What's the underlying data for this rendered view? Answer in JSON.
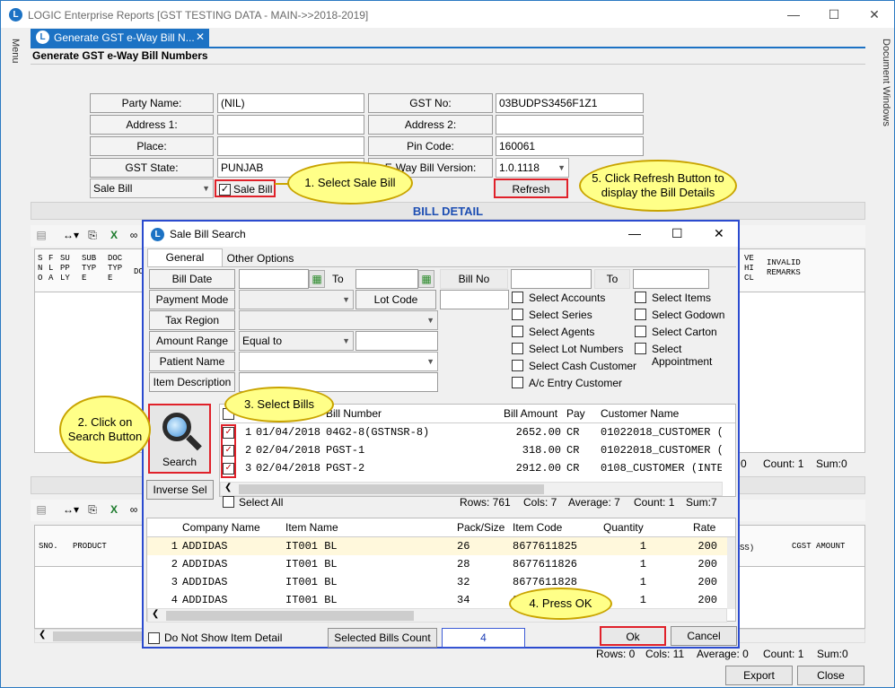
{
  "window": {
    "title": "LOGIC Enterprise Reports  [GST TESTING DATA - MAIN->>2018-2019]",
    "logo_letter": "L"
  },
  "side": {
    "left_label": "Menu",
    "right_label": "Document Windows"
  },
  "tab": {
    "label": "Generate GST e-Way Bill N...",
    "close": "✕"
  },
  "form": {
    "heading": "Generate GST e-Way Bill Numbers",
    "party_name_label": "Party Name:",
    "party_name": "(NIL)",
    "address1_label": "Address 1:",
    "address1": "",
    "place_label": "Place:",
    "place": "",
    "gst_state_label": "GST State:",
    "gst_state": "PUNJAB",
    "gst_no_label": "GST No:",
    "gst_no": "03BUDPS3456F1Z1",
    "address2_label": "Address 2:",
    "address2": "",
    "pin_code_label": "Pin Code:",
    "pin_code": "160061",
    "eway_version_label": "E-Way Bill Version:",
    "eway_version": "1.0.1118",
    "bill_type": "Sale Bill",
    "sale_bill_check_label": "Sale Bill",
    "refresh_label": "Refresh",
    "bill_detail_title": "BILL DETAIL"
  },
  "upper_grid": {
    "headers": [
      "S\nN\nO",
      "F\nL\nA",
      "SU\nPP\nLY",
      "SUB\nTYP\nE",
      "DOC\nTYP\nE",
      "DC"
    ],
    "right_headers": [
      "VE\nHI\nCL",
      "INVALID\nREMARKS"
    ],
    "status": {
      "partial": "0",
      "count": "Count: 1",
      "sum": "Sum:0"
    }
  },
  "lower_grid": {
    "headers": {
      "sno": "SNO.",
      "product": "PRODUCT",
      "ss": "SS)",
      "cgst": "CGST AMOUNT"
    },
    "status": {
      "rows": "Rows: 0",
      "cols": "Cols: 11",
      "average": "Average: 0",
      "count": "Count: 1",
      "sum": "Sum:0"
    }
  },
  "footer": {
    "export": "Export",
    "close": "Close"
  },
  "dialog": {
    "title": "Sale Bill Search",
    "tabs": [
      "General Options",
      "Other Options"
    ],
    "bill_date_label": "Bill Date",
    "to_label": "To",
    "bill_no_label": "Bill No",
    "to2_label": "To",
    "payment_mode_label": "Payment Mode",
    "lot_code_label": "Lot Code",
    "tax_region_label": "Tax Region",
    "amount_range_label": "Amount Range",
    "amount_range_value": "Equal to",
    "patient_name_label": "Patient Name",
    "item_description_label": "Item Description",
    "checks_mid": [
      "Select Accounts",
      "Select Series",
      "Select Agents",
      "Select Lot Numbers",
      "Select Cash Customer",
      "A/c Entry Customer"
    ],
    "checks_right": [
      "Select Items",
      "Select Godown",
      "Select Carton",
      "Select Appointment"
    ],
    "search_label": "Search",
    "inverse_sel_label": "Inverse Sel",
    "select_all_label": "Select All",
    "bills": {
      "headers": {
        "bill_number": "Bill Number",
        "bill_amount": "Bill Amount",
        "pay": "Pay",
        "customer": "Customer Name"
      },
      "rows": [
        {
          "n": "1",
          "date": "01/04/2018",
          "number": "04G2-8(GSTNSR-8)",
          "amount": "2652.00",
          "pay": "CR",
          "customer": "01022018_CUSTOMER (",
          "checked": true
        },
        {
          "n": "2",
          "date": "02/04/2018",
          "number": "PGST-1",
          "amount": "318.00",
          "pay": "CR",
          "customer": "01022018_CUSTOMER (",
          "checked": true
        },
        {
          "n": "3",
          "date": "02/04/2018",
          "number": "PGST-2",
          "amount": "2912.00",
          "pay": "CR",
          "customer": "0108_CUSTOMER (INTE",
          "checked": true
        }
      ],
      "status": {
        "rows": "Rows: 761",
        "cols": "Cols: 7",
        "average": "Average: 7",
        "count": "Count: 1",
        "sum": "Sum:7"
      }
    },
    "items": {
      "headers": {
        "company": "Company Name",
        "item": "Item Name",
        "pack": "Pack/Size",
        "code": "Item Code",
        "qty": "Quantity",
        "rate": "Rate"
      },
      "rows": [
        {
          "n": "1",
          "company": "ADDIDAS",
          "item": "IT001 BL",
          "pack": "26",
          "code": "8677611825",
          "qty": "1",
          "rate": "200"
        },
        {
          "n": "2",
          "company": "ADDIDAS",
          "item": "IT001 BL",
          "pack": "28",
          "code": "8677611826",
          "qty": "1",
          "rate": "200"
        },
        {
          "n": "3",
          "company": "ADDIDAS",
          "item": "IT001 BL",
          "pack": "32",
          "code": "8677611828",
          "qty": "1",
          "rate": "200"
        },
        {
          "n": "4",
          "company": "ADDIDAS",
          "item": "IT001 BL",
          "pack": "34",
          "code": "8677611830",
          "qty": "1",
          "rate": "200"
        }
      ]
    },
    "dont_show_label": "Do Not Show Item Detail",
    "selected_bills_label": "Selected Bills Count",
    "selected_bills_count": "4",
    "ok_label": "Ok",
    "cancel_label": "Cancel"
  },
  "callouts": {
    "c1": "1. Select Sale Bill",
    "c2": "2. Click on Search Button",
    "c3": "3. Select Bills",
    "c4": "4. Press OK",
    "c5": "5. Click Refresh Button to display the Bill Details"
  },
  "colors": {
    "accent": "#1c72c4",
    "highlight_red": "#e0212a",
    "callout_fill": "#ffff88",
    "dialog_border": "#2b4bcf"
  }
}
